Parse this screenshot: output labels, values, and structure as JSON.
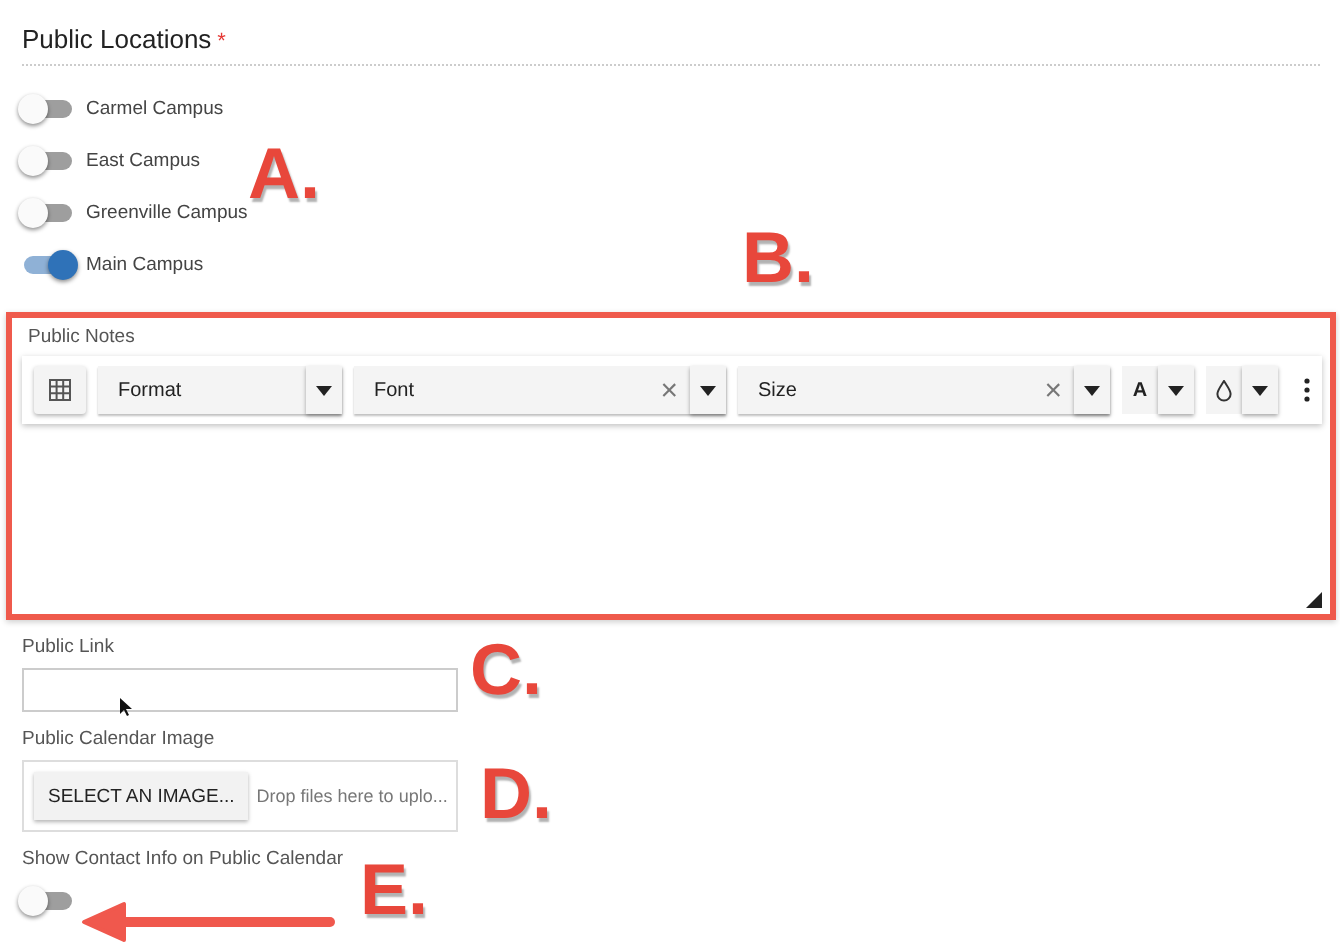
{
  "locations": {
    "label": "Public Locations",
    "required_mark": "*",
    "items": [
      {
        "name": "Carmel Campus",
        "on": false
      },
      {
        "name": "East Campus",
        "on": false
      },
      {
        "name": "Greenville Campus",
        "on": false
      },
      {
        "name": "Main Campus",
        "on": true
      }
    ]
  },
  "notes": {
    "label": "Public Notes",
    "toolbar": [
      {
        "kind": "grid"
      },
      {
        "kind": "select",
        "placeholder": "Format"
      },
      {
        "kind": "select",
        "placeholder": "Font",
        "clear": "×"
      },
      {
        "kind": "select",
        "placeholder": "Size",
        "clear": "×"
      },
      {
        "kind": "textmenu",
        "text": "A"
      },
      {
        "kind": "colormenu"
      }
    ]
  },
  "link": {
    "label": "Public Link"
  },
  "image": {
    "label": "Public Calendar Image",
    "button": "SELECT AN IMAGE...",
    "drop_hint": "Drop files here to uplo..."
  },
  "contact": {
    "label": "Show Contact Info on Public Calendar",
    "on": false
  },
  "annotations": [
    "A.",
    "B.",
    "C.",
    "D.",
    "E."
  ]
}
